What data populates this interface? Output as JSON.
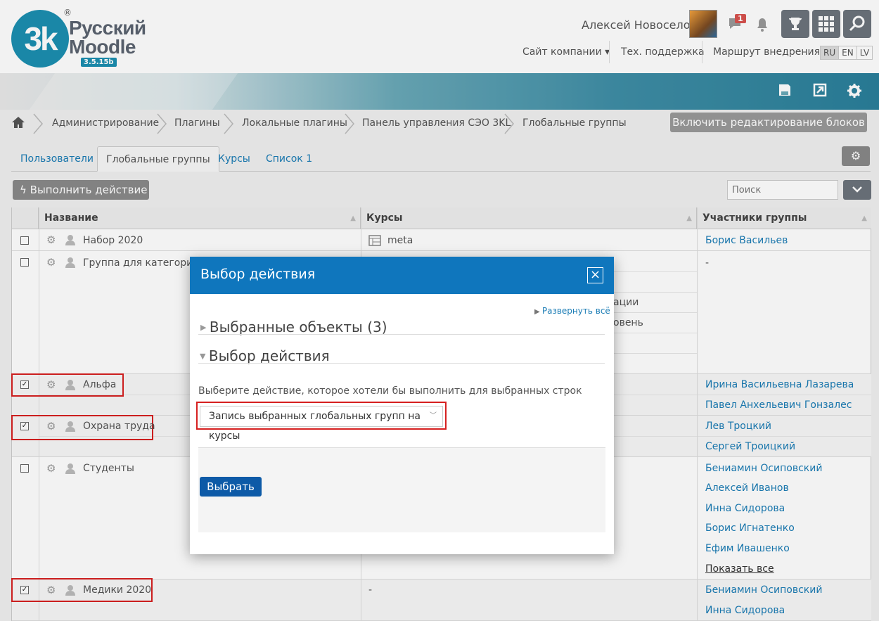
{
  "logo": {
    "mark": "3k",
    "reg": "®",
    "line1": "Русский",
    "line2": "Moodle",
    "version": "3.5.15b"
  },
  "header": {
    "user_name": "Алексей Новоселов",
    "message_count": "1",
    "links": [
      "Сайт компании ▾",
      "Тех. поддержка",
      "Маршрут внедрения"
    ],
    "languages": [
      "RU",
      "EN",
      "LV"
    ],
    "active_language": "RU"
  },
  "breadcrumb": [
    "Администрирование",
    "Плагины",
    "Локальные плагины",
    "Панель управления СЭО 3KL",
    "Глобальные группы"
  ],
  "edit_blocks_label": "Включить редактирование блоков",
  "tabs": [
    "Пользователи",
    "Глобальные группы",
    "Курсы",
    "Список 1"
  ],
  "actions": {
    "execute_label": "Выполнить действие",
    "search_placeholder": "Поиск"
  },
  "table": {
    "headers": [
      "Название",
      "Курсы",
      "Участники группы"
    ],
    "rows": [
      {
        "name": "Набор 2020",
        "checked": false,
        "course": "meta",
        "members": [
          "Борис Васильев"
        ]
      },
      {
        "name": "Группа для категории Д",
        "checked": false,
        "course_fragments": [
          "ации",
          "овень"
        ],
        "members": [
          "-"
        ]
      },
      {
        "name": "Альфа",
        "checked": true,
        "members": [
          "Ирина Васильевна Лазарева",
          "Павел Анхельевич Гонзалес"
        ]
      },
      {
        "name": "Охрана труда",
        "checked": true,
        "members": [
          "Лев Троцкий",
          "Сергей Троицкий"
        ]
      },
      {
        "name": "Студенты",
        "checked": false,
        "members": [
          "Бениамин Осиповский",
          "Алексей Иванов",
          "Инна Сидорова",
          "Борис Игнатенко",
          "Ефим Ивашенко"
        ],
        "show_all": "Показать все"
      },
      {
        "name": "Медики 2020",
        "checked": true,
        "course": "-",
        "members": [
          "Бениамин Осиповский",
          "Инна Сидорова"
        ]
      }
    ]
  },
  "modal": {
    "title": "Выбор действия",
    "close": "×",
    "expand_all": "Развернуть всё",
    "section1": "Выбранные объекты (3)",
    "section2": "Выбор действия",
    "select_label": "Выберите действие, которое хотели бы выполнить для выбранных строк",
    "select_value": "Запись выбранных глобальных групп на курсы",
    "submit_label": "Выбрать"
  },
  "colors": {
    "accent": "#0f76bd",
    "link": "#1a7cb5",
    "highlight": "#d62020",
    "primary_button": "#0d5aa7"
  },
  "icons": [
    "home-icon",
    "chevron-right-icon",
    "message-icon",
    "bell-icon",
    "trophy-icon",
    "grid-icon",
    "search-icon",
    "save-icon",
    "send-icon",
    "gear-icon",
    "lightning-icon",
    "chevron-down-icon",
    "user-icon",
    "table-icon",
    "caret-right-icon",
    "caret-down-icon"
  ]
}
